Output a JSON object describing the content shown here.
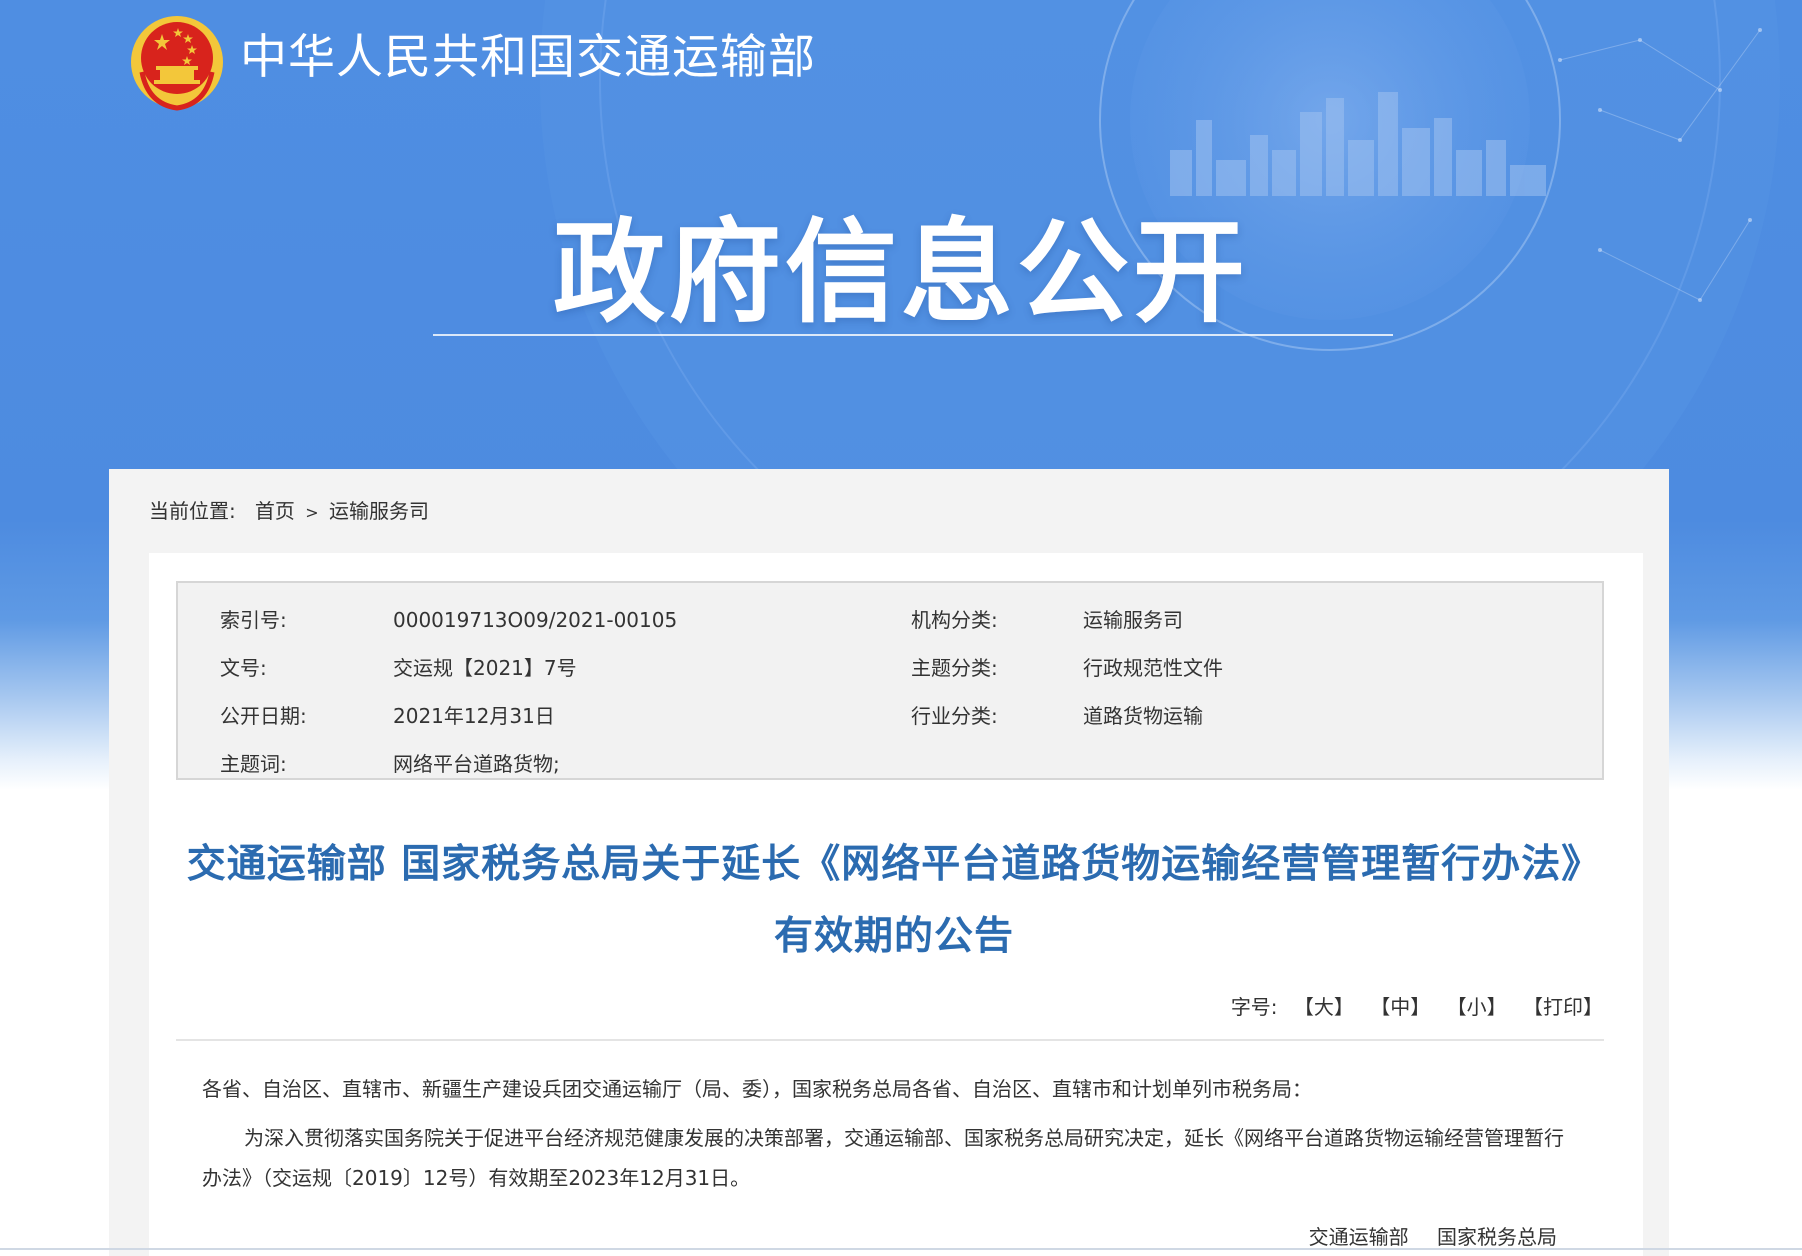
{
  "header": {
    "site_name": "中华人民共和国交通运输部",
    "banner_title": "政府信息公开"
  },
  "breadcrumb": {
    "label": "当前位置:",
    "items": [
      "首页",
      "运输服务司"
    ],
    "separator": ">"
  },
  "meta": {
    "rows": [
      {
        "k1": "索引号:",
        "v1": "000019713O09/2021-00105",
        "k2": "机构分类:",
        "v2": "运输服务司"
      },
      {
        "k1": "文号:",
        "v1": "交运规【2021】7号",
        "k2": "主题分类:",
        "v2": "行政规范性文件"
      },
      {
        "k1": "公开日期:",
        "v1": "2021年12月31日",
        "k2": "行业分类:",
        "v2": "道路货物运输"
      },
      {
        "k1": "主题词:",
        "v1": "网络平台道路货物;",
        "k2": "",
        "v2": ""
      }
    ]
  },
  "document": {
    "title": "交通运输部 国家税务总局关于延长《网络平台道路货物运输经营管理暂行办法》有效期的公告",
    "font_tools": {
      "label": "字号:",
      "large": "【大】",
      "medium": "【中】",
      "small": "【小】",
      "print": "【打印】"
    },
    "paragraph_1": "各省、自治区、直辖市、新疆生产建设兵团交通运输厅（局、委），国家税务总局各省、自治区、直辖市和计划单列市税务局：",
    "paragraph_2": "为深入贯彻落实国务院关于促进平台经济规范健康发展的决策部署，交通运输部、国家税务总局研究决定，延长《网络平台道路货物运输经营管理暂行办法》（交运规〔2019〕12号）有效期至2023年12月31日。",
    "signatures": [
      "交通运输部",
      "国家税务总局"
    ]
  },
  "colors": {
    "banner_blue": "#4f8ee2",
    "title_blue": "#2b6bb0",
    "emblem_red": "#d8231c",
    "emblem_gold": "#f3c73a"
  }
}
